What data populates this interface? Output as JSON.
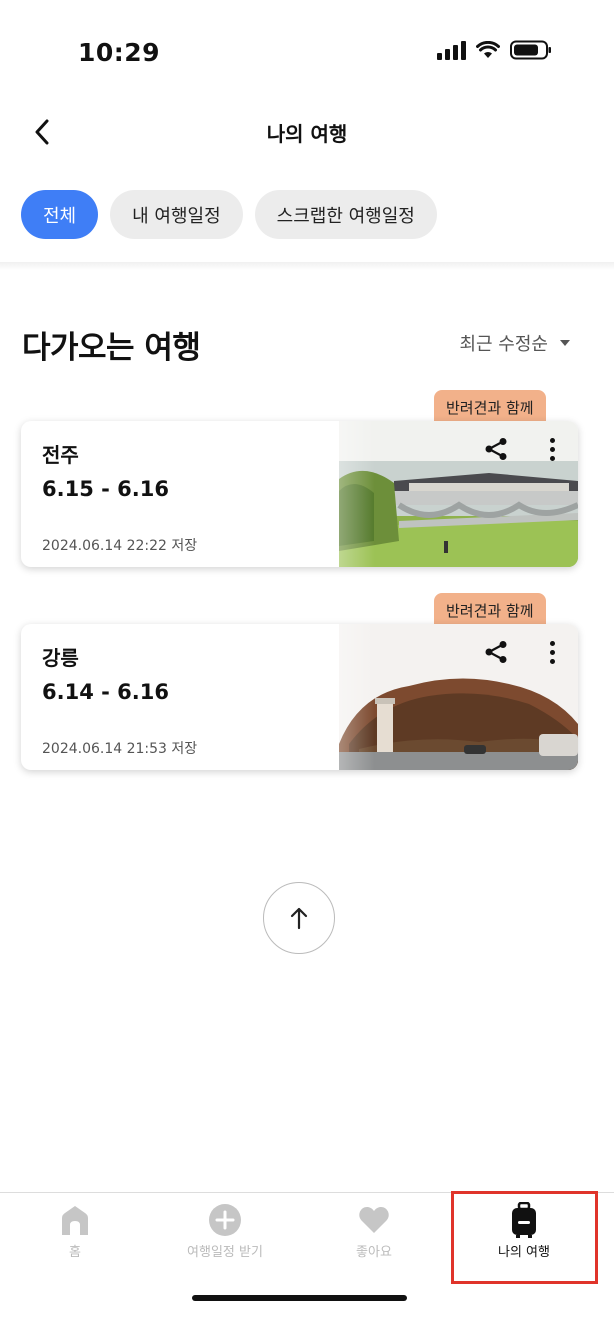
{
  "status_bar": {
    "time": "10:29"
  },
  "header": {
    "title": "나의 여행"
  },
  "filters": [
    {
      "label": "전체",
      "active": true
    },
    {
      "label": "내 여행일정",
      "active": false
    },
    {
      "label": "스크랩한 여행일정",
      "active": false
    }
  ],
  "section": {
    "title": "다가오는 여행",
    "sort_label": "최근 수정순"
  },
  "trips": [
    {
      "tag": "반려견과 함께",
      "name": "전주",
      "dates": "6.15 - 6.16",
      "saved": "2024.06.14  22:22  저장"
    },
    {
      "tag": "반려견과 함께",
      "name": "강릉",
      "dates": "6.14 - 6.16",
      "saved": "2024.06.14  21:53  저장"
    }
  ],
  "tab_bar": [
    {
      "label": "홈",
      "icon": "home-icon",
      "active": false
    },
    {
      "label": "여행일정 받기",
      "icon": "add-circle-icon",
      "active": false
    },
    {
      "label": "좋아요",
      "icon": "heart-icon",
      "active": false
    },
    {
      "label": "나의 여행",
      "icon": "suitcase-icon",
      "active": true
    }
  ],
  "colors": {
    "accent": "#3f7ef6",
    "tag": "#f2b18a",
    "highlight": "#e0342a",
    "inactive_tab": "#bbbbbb"
  }
}
